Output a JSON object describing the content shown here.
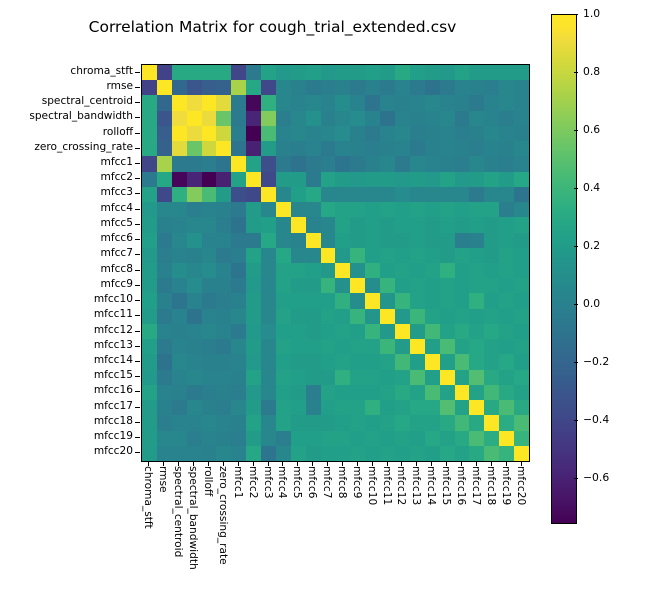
{
  "title": "Correlation Matrix for cough_trial_extended.csv",
  "colormap": "viridis",
  "chart_data": {
    "type": "heatmap",
    "title": "Correlation Matrix for cough_trial_extended.csv",
    "xlabel": "",
    "ylabel": "",
    "colormap": "viridis",
    "grid": false,
    "legend_position": "right-colorbar",
    "colorbar": {
      "vmin": -0.75,
      "vmax": 1.0,
      "ticks": [
        1.0,
        0.8,
        0.6,
        0.4,
        0.2,
        0.0,
        -0.2,
        -0.4,
        -0.6
      ],
      "tick_labels": [
        "1.0",
        "0.8",
        "0.6",
        "0.4",
        "0.2",
        "0.0",
        "−0.2",
        "−0.4",
        "−0.6"
      ]
    },
    "categories": [
      "chroma_stft",
      "rmse",
      "spectral_centroid",
      "spectral_bandwidth",
      "rolloff",
      "zero_crossing_rate",
      "mfcc1",
      "mfcc2",
      "mfcc3",
      "mfcc4",
      "mfcc5",
      "mfcc6",
      "mfcc7",
      "mfcc8",
      "mfcc9",
      "mfcc10",
      "mfcc11",
      "mfcc12",
      "mfcc13",
      "mfcc14",
      "mfcc15",
      "mfcc16",
      "mfcc17",
      "mfcc18",
      "mfcc19",
      "mfcc20"
    ],
    "x": [
      "chroma_stft",
      "rmse",
      "spectral_centroid",
      "spectral_bandwidth",
      "rolloff",
      "zero_crossing_rate",
      "mfcc1",
      "mfcc2",
      "mfcc3",
      "mfcc4",
      "mfcc5",
      "mfcc6",
      "mfcc7",
      "mfcc8",
      "mfcc9",
      "mfcc10",
      "mfcc11",
      "mfcc12",
      "mfcc13",
      "mfcc14",
      "mfcc15",
      "mfcc16",
      "mfcc17",
      "mfcc18",
      "mfcc19",
      "mfcc20"
    ],
    "y": [
      "chroma_stft",
      "rmse",
      "spectral_centroid",
      "spectral_bandwidth",
      "rolloff",
      "zero_crossing_rate",
      "mfcc1",
      "mfcc2",
      "mfcc3",
      "mfcc4",
      "mfcc5",
      "mfcc6",
      "mfcc7",
      "mfcc8",
      "mfcc9",
      "mfcc10",
      "mfcc11",
      "mfcc12",
      "mfcc13",
      "mfcc14",
      "mfcc15",
      "mfcc16",
      "mfcc17",
      "mfcc18",
      "mfcc19",
      "mfcc20"
    ],
    "values": [
      [
        1.0,
        -0.42,
        0.3,
        0.3,
        0.3,
        0.3,
        -0.4,
        -0.05,
        0.25,
        0.18,
        0.2,
        0.22,
        0.18,
        0.2,
        0.2,
        0.22,
        0.2,
        0.3,
        0.22,
        0.2,
        0.18,
        0.25,
        0.2,
        0.2,
        0.2,
        0.2
      ],
      [
        -0.42,
        1.0,
        -0.18,
        -0.3,
        -0.25,
        -0.22,
        0.72,
        0.28,
        -0.38,
        0.05,
        0.0,
        -0.05,
        -0.02,
        0.0,
        -0.05,
        0.0,
        -0.05,
        0.02,
        -0.05,
        -0.1,
        -0.05,
        0.02,
        0.0,
        -0.02,
        0.05,
        0.02
      ],
      [
        0.3,
        -0.18,
        1.0,
        0.92,
        0.97,
        0.88,
        -0.05,
        -0.72,
        0.35,
        0.05,
        0.02,
        0.05,
        0.02,
        0.1,
        0.02,
        -0.08,
        0.02,
        0.0,
        0.02,
        0.05,
        0.02,
        0.0,
        -0.05,
        0.02,
        0.05,
        0.02
      ],
      [
        0.3,
        -0.3,
        0.92,
        1.0,
        0.9,
        0.55,
        -0.05,
        -0.58,
        0.62,
        -0.02,
        0.05,
        0.12,
        0.0,
        0.05,
        0.08,
        0.02,
        -0.1,
        0.02,
        0.0,
        0.02,
        0.05,
        -0.05,
        0.05,
        0.02,
        -0.02,
        0.02
      ],
      [
        0.3,
        -0.25,
        0.97,
        0.9,
        1.0,
        0.82,
        -0.02,
        -0.75,
        0.45,
        0.02,
        0.05,
        0.02,
        0.05,
        0.08,
        0.0,
        -0.05,
        0.02,
        0.05,
        -0.02,
        0.0,
        0.02,
        -0.02,
        0.0,
        0.05,
        0.02,
        0.0
      ],
      [
        0.3,
        -0.22,
        0.88,
        0.55,
        0.82,
        1.0,
        -0.08,
        -0.6,
        0.2,
        0.0,
        -0.02,
        0.02,
        -0.05,
        0.02,
        0.0,
        -0.02,
        0.0,
        0.02,
        -0.05,
        0.0,
        0.02,
        0.0,
        -0.02,
        0.02,
        0.0,
        0.05
      ],
      [
        -0.4,
        0.72,
        -0.05,
        -0.05,
        -0.02,
        -0.08,
        1.0,
        0.25,
        -0.35,
        -0.05,
        -0.1,
        -0.05,
        -0.02,
        -0.08,
        -0.05,
        0.0,
        0.05,
        -0.05,
        0.05,
        0.02,
        0.0,
        -0.02,
        0.05,
        0.0,
        -0.02,
        0.02
      ],
      [
        -0.05,
        0.28,
        -0.72,
        -0.58,
        -0.75,
        -0.6,
        0.25,
        1.0,
        -0.38,
        0.2,
        0.2,
        -0.05,
        0.25,
        0.2,
        0.18,
        0.2,
        0.2,
        0.18,
        0.2,
        0.18,
        0.25,
        0.18,
        0.2,
        0.25,
        0.2,
        0.28
      ],
      [
        0.25,
        -0.38,
        0.35,
        0.62,
        0.45,
        0.2,
        -0.35,
        -0.38,
        1.0,
        0.05,
        0.22,
        0.28,
        0.05,
        0.05,
        0.05,
        0.05,
        0.05,
        0.08,
        0.05,
        0.05,
        0.05,
        0.05,
        -0.05,
        0.05,
        0.05,
        -0.08
      ],
      [
        0.18,
        0.05,
        0.05,
        -0.02,
        0.02,
        0.0,
        -0.05,
        0.2,
        0.05,
        1.0,
        0.05,
        0.05,
        0.28,
        0.25,
        0.25,
        0.22,
        0.25,
        0.22,
        0.25,
        0.22,
        0.25,
        0.22,
        0.25,
        0.25,
        -0.02,
        0.05
      ],
      [
        0.2,
        0.0,
        0.02,
        0.05,
        0.05,
        -0.02,
        -0.1,
        0.2,
        0.22,
        0.05,
        1.0,
        0.02,
        0.05,
        0.25,
        0.2,
        0.22,
        0.2,
        0.22,
        0.22,
        0.2,
        0.22,
        0.2,
        0.22,
        0.2,
        0.22,
        0.25
      ],
      [
        0.22,
        -0.05,
        0.05,
        0.12,
        0.02,
        0.02,
        -0.05,
        -0.05,
        0.28,
        0.05,
        0.02,
        1.0,
        0.05,
        0.22,
        0.2,
        0.22,
        0.2,
        0.2,
        0.22,
        0.2,
        0.2,
        -0.02,
        0.0,
        0.2,
        0.22,
        0.2
      ],
      [
        0.18,
        -0.02,
        0.02,
        0.0,
        0.05,
        -0.05,
        -0.02,
        0.25,
        0.05,
        0.28,
        0.05,
        0.05,
        1.0,
        0.18,
        0.38,
        0.22,
        0.25,
        0.22,
        0.25,
        0.22,
        0.2,
        0.25,
        0.22,
        0.2,
        0.25,
        0.22
      ],
      [
        0.2,
        0.0,
        0.1,
        0.05,
        0.08,
        0.02,
        -0.08,
        0.2,
        0.05,
        0.25,
        0.25,
        0.22,
        0.18,
        1.0,
        0.12,
        0.35,
        0.22,
        0.25,
        0.22,
        0.25,
        0.35,
        0.22,
        0.25,
        0.22,
        0.25,
        0.22
      ],
      [
        0.2,
        -0.05,
        0.02,
        0.08,
        0.0,
        0.0,
        -0.05,
        0.18,
        0.05,
        0.25,
        0.2,
        0.2,
        0.38,
        0.12,
        1.0,
        0.1,
        0.38,
        0.22,
        0.25,
        0.22,
        0.25,
        0.22,
        0.25,
        0.25,
        0.22,
        0.25
      ],
      [
        0.22,
        0.0,
        -0.08,
        0.02,
        -0.05,
        -0.02,
        0.0,
        0.2,
        0.05,
        0.22,
        0.22,
        0.22,
        0.22,
        0.35,
        0.1,
        1.0,
        0.15,
        0.38,
        0.25,
        0.22,
        0.25,
        0.22,
        0.35,
        0.22,
        0.25,
        0.22
      ],
      [
        0.2,
        -0.05,
        0.02,
        -0.1,
        0.02,
        0.0,
        0.05,
        0.2,
        0.05,
        0.25,
        0.2,
        0.2,
        0.25,
        0.22,
        0.38,
        0.15,
        1.0,
        0.18,
        0.4,
        0.25,
        0.22,
        0.25,
        0.22,
        0.25,
        0.22,
        0.25
      ],
      [
        0.3,
        0.02,
        0.0,
        0.02,
        0.05,
        0.02,
        -0.05,
        0.18,
        0.08,
        0.22,
        0.22,
        0.2,
        0.22,
        0.25,
        0.22,
        0.38,
        0.18,
        1.0,
        0.2,
        0.42,
        0.25,
        0.3,
        0.25,
        0.28,
        0.25,
        0.22
      ],
      [
        0.22,
        -0.05,
        0.02,
        0.0,
        -0.02,
        -0.05,
        0.05,
        0.2,
        0.05,
        0.25,
        0.22,
        0.22,
        0.25,
        0.22,
        0.25,
        0.25,
        0.4,
        0.2,
        1.0,
        0.22,
        0.45,
        0.25,
        0.28,
        0.25,
        0.22,
        0.25
      ],
      [
        0.2,
        -0.1,
        0.05,
        0.02,
        0.0,
        0.0,
        0.02,
        0.18,
        0.05,
        0.22,
        0.2,
        0.2,
        0.22,
        0.25,
        0.22,
        0.22,
        0.25,
        0.42,
        0.22,
        1.0,
        0.22,
        0.45,
        0.28,
        0.25,
        0.28,
        0.22
      ],
      [
        0.18,
        -0.05,
        0.02,
        0.05,
        0.02,
        0.02,
        0.0,
        0.25,
        0.05,
        0.25,
        0.22,
        0.2,
        0.2,
        0.35,
        0.25,
        0.25,
        0.22,
        0.25,
        0.45,
        0.22,
        1.0,
        0.25,
        0.48,
        0.3,
        0.25,
        0.28
      ],
      [
        0.25,
        0.02,
        0.0,
        -0.05,
        -0.02,
        0.0,
        -0.02,
        0.18,
        0.05,
        0.22,
        0.2,
        -0.02,
        0.25,
        0.22,
        0.22,
        0.22,
        0.25,
        0.3,
        0.25,
        0.45,
        0.25,
        1.0,
        0.25,
        0.42,
        0.3,
        0.25
      ],
      [
        0.2,
        0.0,
        -0.05,
        0.05,
        0.0,
        -0.02,
        0.05,
        0.2,
        -0.05,
        0.25,
        0.22,
        0.0,
        0.22,
        0.25,
        0.25,
        0.35,
        0.22,
        0.25,
        0.28,
        0.28,
        0.48,
        0.25,
        1.0,
        0.3,
        0.45,
        0.3
      ],
      [
        0.2,
        -0.02,
        0.02,
        0.02,
        0.05,
        0.02,
        0.0,
        0.25,
        0.05,
        0.25,
        0.2,
        0.2,
        0.2,
        0.22,
        0.25,
        0.22,
        0.25,
        0.28,
        0.25,
        0.25,
        0.3,
        0.42,
        0.3,
        1.0,
        0.32,
        0.45
      ],
      [
        0.2,
        0.05,
        0.05,
        -0.02,
        0.02,
        0.0,
        -0.02,
        0.2,
        0.05,
        -0.02,
        0.22,
        0.22,
        0.25,
        0.25,
        0.22,
        0.25,
        0.22,
        0.25,
        0.22,
        0.28,
        0.25,
        0.3,
        0.45,
        0.32,
        1.0,
        0.38
      ],
      [
        0.2,
        0.02,
        0.02,
        0.02,
        0.0,
        0.05,
        0.02,
        0.28,
        -0.08,
        0.05,
        0.25,
        0.2,
        0.22,
        0.22,
        0.25,
        0.22,
        0.25,
        0.22,
        0.25,
        0.22,
        0.28,
        0.25,
        0.3,
        0.45,
        0.38,
        1.0
      ]
    ]
  }
}
